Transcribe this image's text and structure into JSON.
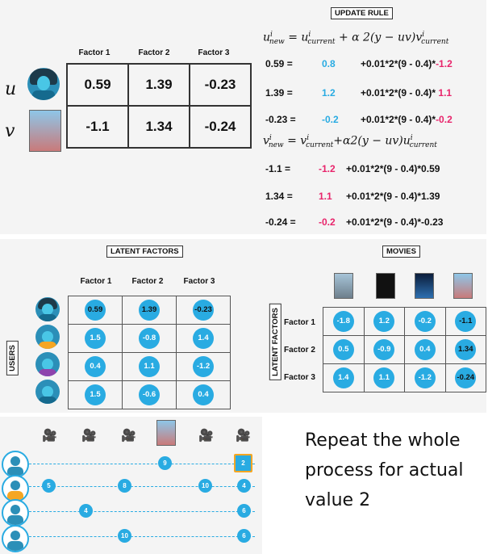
{
  "top": {
    "title": "UPDATE RULE",
    "factor_headers": [
      "Factor 1",
      "Factor 2",
      "Factor 3"
    ],
    "u_label": "u",
    "v_label": "v",
    "u_values": [
      "0.59",
      "1.39",
      "-0.23"
    ],
    "v_values": [
      "-1.1",
      "1.34",
      "-0.24"
    ],
    "u_rule": {
      "lhs": "u",
      "lhs_sup": "i",
      "lhs_sub": "new",
      "eq": " = ",
      "cur": "u",
      "cur_sup": "i",
      "cur_sub": "current",
      "plus": " + ",
      "mid": "α 2(y − uv)v",
      "mid_sup": "i",
      "mid_sub": "current"
    },
    "v_rule": {
      "lhs": "v",
      "lhs_sup": "i",
      "lhs_sub": "new",
      "eq": " = ",
      "cur": "v",
      "cur_sup": "i",
      "cur_sub": "current",
      "plus": "+",
      "mid": "α2(y − uv)u",
      "mid_sup": "i",
      "mid_sub": "current"
    },
    "u_rows": [
      {
        "lhs": "0.59 =",
        "cur": "0.8",
        "expr": "+0.01*2*(9 - 0.4)*",
        "factor": "-1.2"
      },
      {
        "lhs": "1.39 =",
        "cur": "1.2",
        "expr": "+0.01*2*(9 - 0.4)* ",
        "factor": "1.1"
      },
      {
        "lhs": "-0.23 =",
        "cur": "-0.2",
        "expr": "+0.01*2*(9 - 0.4)*",
        "factor": "-0.2"
      }
    ],
    "v_rows": [
      {
        "lhs": "-1.1 =",
        "cur": "-1.2",
        "expr": "+0.01*2*(9 - 0.4)*0.59"
      },
      {
        "lhs": "1.34 =",
        "cur": "1.1",
        "expr": "+0.01*2*(9 - 0.4)*1.39"
      },
      {
        "lhs": "-0.24 =",
        "cur": "-0.2",
        "expr": "+0.01*2*(9 - 0.4)*-0.23"
      }
    ]
  },
  "mid": {
    "latent_title": "LATENT FACTORS",
    "movies_title": "MOVIES",
    "users_label": "USERS",
    "latent_factors_label": "LATENT FACTORS",
    "factor_headers": [
      "Factor 1",
      "Factor 2",
      "Factor 3"
    ],
    "user_matrix": [
      [
        "0.59",
        "1.39",
        "-0.23"
      ],
      [
        "1.5",
        "-0.8",
        "1.4"
      ],
      [
        "0.4",
        "1.1",
        "-1.2"
      ],
      [
        "1.5",
        "-0.6",
        "0.4"
      ]
    ],
    "movie_row_labels": [
      "Factor 1",
      "Factor 2",
      "Factor 3"
    ],
    "movie_matrix": [
      [
        "-1.8",
        "1.2",
        "-0.2",
        "-1.1"
      ],
      [
        "0.5",
        "-0.9",
        "0.4",
        "1.34"
      ],
      [
        "1.4",
        "1.1",
        "-1.2",
        "-0.24"
      ]
    ]
  },
  "bottom": {
    "ratings": {
      "row1": [
        "9",
        "2"
      ],
      "row2": [
        "5",
        "8",
        "10",
        "4"
      ],
      "row3": [
        "4",
        "6"
      ],
      "row4": [
        "10",
        "6"
      ]
    },
    "repeat_text": "Repeat the whole process for actual value 2"
  },
  "colors": {
    "accent": "#29abe2",
    "highlight": "#e8246b",
    "box_highlight": "#f5a623"
  }
}
